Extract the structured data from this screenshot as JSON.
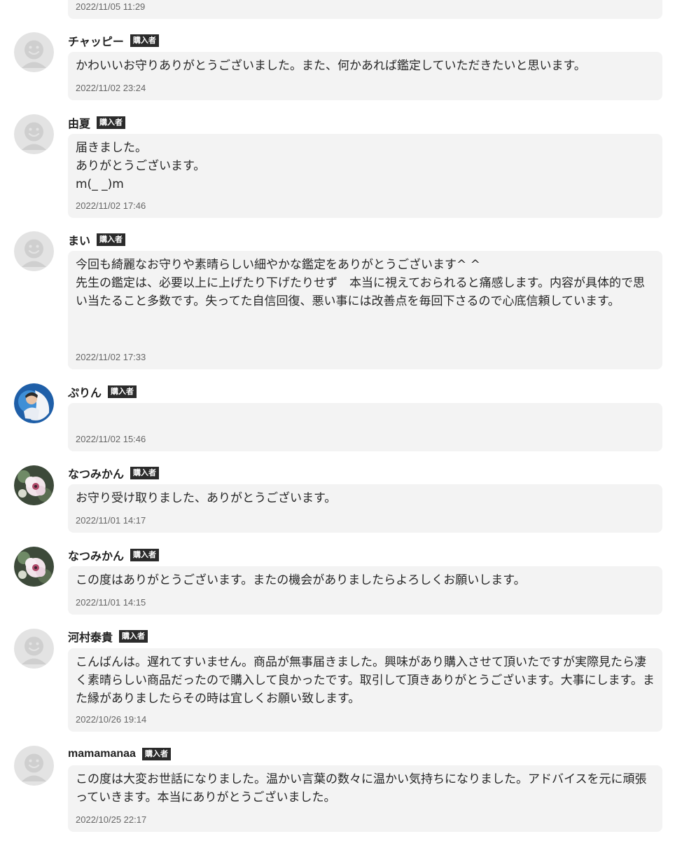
{
  "badge_label": "購入者",
  "first_partial": {
    "timestamp": "2022/11/05 11:29"
  },
  "comments": [
    {
      "name": "チャッピー",
      "avatar": "default-user-icon",
      "text": "かわいいお守りありがとうございました。また、何かあれば鑑定していただきたいと思います。",
      "timestamp": "2022/11/02 23:24"
    },
    {
      "name": "由夏",
      "avatar": "default-user-icon",
      "text": "届きました。\nありがとうございます。\nm(_ _)m",
      "timestamp": "2022/11/02 17:46"
    },
    {
      "name": "まい",
      "avatar": "default-user-icon",
      "text": "今回も綺麗なお守りや素晴らしい細やかな鑑定をありがとうございます^ ^\n先生の鑑定は、必要以上に上げたり下げたりせず　本当に視えておられると痛感します。内容が具体的で思い当たること多数です。失ってた自信回復、悪い事には改善点を毎回下さるので心底信頼しています。",
      "timestamp": "2022/11/02 17:33"
    },
    {
      "name": "ぷりん",
      "avatar": "photo-avatar",
      "text": "",
      "timestamp": "2022/11/02 15:46"
    },
    {
      "name": "なつみかん",
      "avatar": "flower-avatar",
      "text": "お守り受け取りました、ありがとうございます。",
      "timestamp": "2022/11/01 14:17"
    },
    {
      "name": "なつみかん",
      "avatar": "flower-avatar",
      "text": "この度はありがとうございます。またの機会がありましたらよろしくお願いします。",
      "timestamp": "2022/11/01 14:15"
    },
    {
      "name": "河村泰貴",
      "avatar": "default-user-icon",
      "text": "こんばんは。遅れてすいません。商品が無事届きました。興味があり購入させて頂いたですが実際見たら凄く素晴らしい商品だったので購入して良かったです。取引して頂きありがとうございます。大事にします。また縁がありましたらその時は宜しくお願い致します。",
      "timestamp": "2022/10/26 19:14"
    },
    {
      "name": "mamamanaa",
      "avatar": "default-user-icon",
      "text": "この度は大変お世話になりました。温かい言葉の数々に温かい気持ちになりました。アドバイスを元に頑張っていきます。本当にありがとうございました。",
      "timestamp": "2022/10/25 22:17"
    }
  ]
}
